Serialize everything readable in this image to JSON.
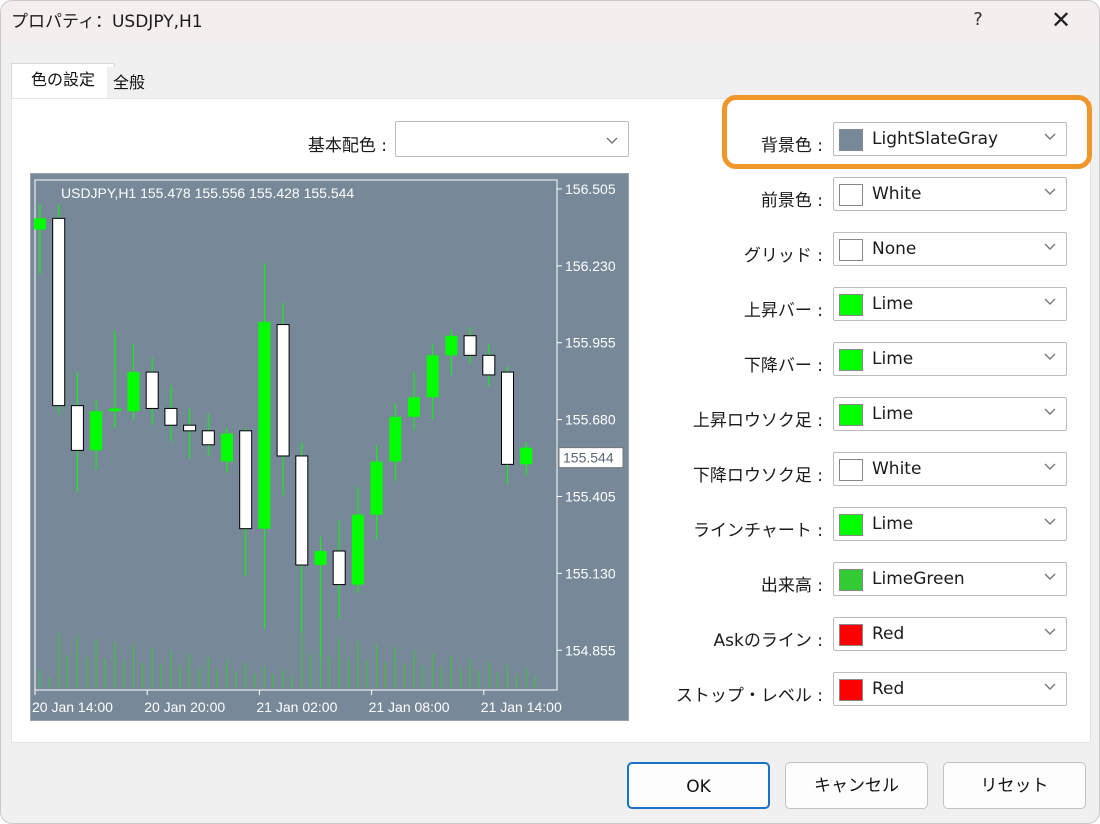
{
  "window": {
    "title": "プロパティ：USDJPY,H1",
    "help_label": "?",
    "close_label": "✕"
  },
  "tabs": [
    {
      "label": "色の設定"
    },
    {
      "label": "全般"
    }
  ],
  "basic_color": {
    "label": "基本配色 :",
    "value": ""
  },
  "colors": {
    "highlight": "#f0962b",
    "background": "#778899",
    "up": "#00ff00",
    "down_body": "#ffffff",
    "red": "#ff0000",
    "limegreen": "#32cd32"
  },
  "settings": [
    {
      "label": "背景色 :",
      "value": "LightSlateGray",
      "swatch": "#778899"
    },
    {
      "label": "前景色 :",
      "value": "White",
      "swatch": "#ffffff"
    },
    {
      "label": "グリッド :",
      "value": "None",
      "swatch": "#ffffff"
    },
    {
      "label": "上昇バー :",
      "value": "Lime",
      "swatch": "#00ff00"
    },
    {
      "label": "下降バー :",
      "value": "Lime",
      "swatch": "#00ff00"
    },
    {
      "label": "上昇ロウソク足 :",
      "value": "Lime",
      "swatch": "#00ff00"
    },
    {
      "label": "下降ロウソク足 :",
      "value": "White",
      "swatch": "#ffffff"
    },
    {
      "label": "ラインチャート :",
      "value": "Lime",
      "swatch": "#00ff00"
    },
    {
      "label": "出来高 :",
      "value": "LimeGreen",
      "swatch": "#32cd32"
    },
    {
      "label": "Askのライン :",
      "value": "Red",
      "swatch": "#ff0000"
    },
    {
      "label": "ストップ・レベル :",
      "value": "Red",
      "swatch": "#ff0000"
    }
  ],
  "chart_data": {
    "type": "candlestick",
    "title": "USDJPY,H1 155.478 155.556 155.428 155.544",
    "ylim": [
      154.72,
      156.53
    ],
    "yticks": [
      "156.505",
      "156.230",
      "155.955",
      "155.680",
      "155.405",
      "155.130",
      "154.855"
    ],
    "last_price": "155.544",
    "xticks": [
      {
        "index": 0,
        "label": "20 Jan 14:00"
      },
      {
        "index": 6,
        "label": "20 Jan 20:00"
      },
      {
        "index": 12,
        "label": "21 Jan 02:00"
      },
      {
        "index": 18,
        "label": "21 Jan 08:00"
      },
      {
        "index": 24,
        "label": "21 Jan 14:00"
      }
    ],
    "candles": [
      {
        "o": 156.36,
        "h": 156.45,
        "l": 156.2,
        "c": 156.4
      },
      {
        "o": 156.4,
        "h": 156.45,
        "l": 155.7,
        "c": 155.73
      },
      {
        "o": 155.73,
        "h": 155.85,
        "l": 155.42,
        "c": 155.57
      },
      {
        "o": 155.57,
        "h": 155.75,
        "l": 155.5,
        "c": 155.71
      },
      {
        "o": 155.71,
        "h": 156.0,
        "l": 155.65,
        "c": 155.72
      },
      {
        "o": 155.71,
        "h": 155.95,
        "l": 155.68,
        "c": 155.85
      },
      {
        "o": 155.85,
        "h": 155.9,
        "l": 155.66,
        "c": 155.72
      },
      {
        "o": 155.72,
        "h": 155.8,
        "l": 155.6,
        "c": 155.66
      },
      {
        "o": 155.66,
        "h": 155.72,
        "l": 155.54,
        "c": 155.64
      },
      {
        "o": 155.64,
        "h": 155.7,
        "l": 155.55,
        "c": 155.59
      },
      {
        "o": 155.53,
        "h": 155.65,
        "l": 155.49,
        "c": 155.63
      },
      {
        "o": 155.64,
        "h": 155.65,
        "l": 155.12,
        "c": 155.29
      },
      {
        "o": 155.29,
        "h": 156.24,
        "l": 154.93,
        "c": 156.03
      },
      {
        "o": 156.02,
        "h": 156.1,
        "l": 155.41,
        "c": 155.55
      },
      {
        "o": 155.55,
        "h": 155.6,
        "l": 154.92,
        "c": 155.16
      },
      {
        "o": 155.16,
        "h": 155.26,
        "l": 154.83,
        "c": 155.21
      },
      {
        "o": 155.21,
        "h": 155.32,
        "l": 154.97,
        "c": 155.09
      },
      {
        "o": 155.09,
        "h": 155.44,
        "l": 155.06,
        "c": 155.34
      },
      {
        "o": 155.34,
        "h": 155.59,
        "l": 155.25,
        "c": 155.53
      },
      {
        "o": 155.53,
        "h": 155.74,
        "l": 155.46,
        "c": 155.69
      },
      {
        "o": 155.69,
        "h": 155.85,
        "l": 155.64,
        "c": 155.76
      },
      {
        "o": 155.76,
        "h": 155.95,
        "l": 155.68,
        "c": 155.91
      },
      {
        "o": 155.91,
        "h": 156.0,
        "l": 155.84,
        "c": 155.98
      },
      {
        "o": 155.98,
        "h": 156.01,
        "l": 155.88,
        "c": 155.91
      },
      {
        "o": 155.91,
        "h": 155.95,
        "l": 155.8,
        "c": 155.84
      },
      {
        "o": 155.85,
        "h": 155.87,
        "l": 155.45,
        "c": 155.52
      },
      {
        "o": 155.52,
        "h": 155.6,
        "l": 155.48,
        "c": 155.58
      }
    ]
  },
  "footer": {
    "ok": "OK",
    "cancel": "キャンセル",
    "reset": "リセット"
  }
}
